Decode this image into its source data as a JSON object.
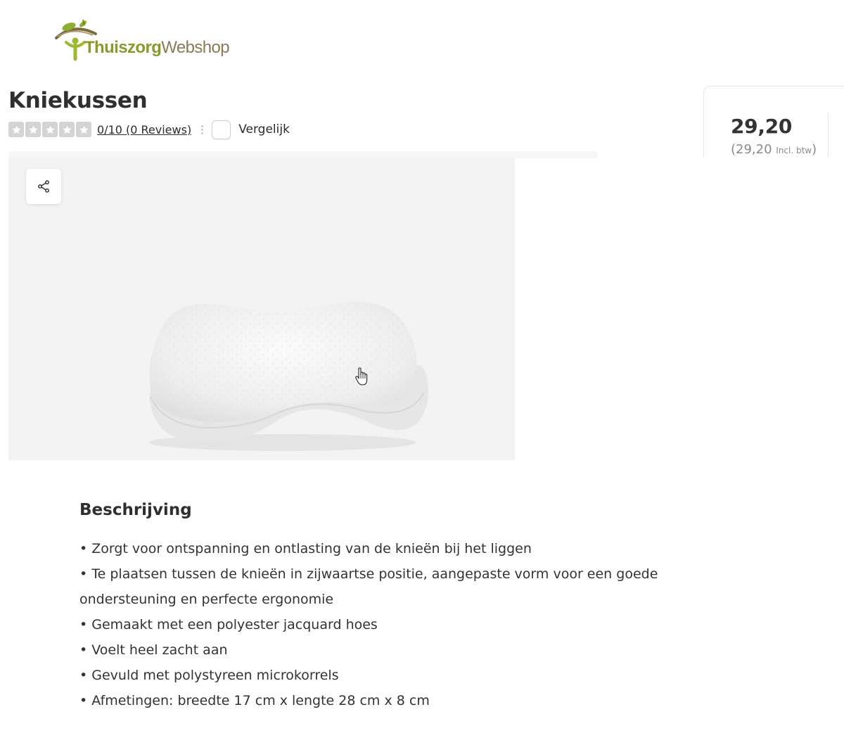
{
  "header": {
    "logo_part1": "Thuiszorg",
    "logo_part2": "Webshop"
  },
  "product": {
    "title": "Kniekussen",
    "rating": 0,
    "rating_max": 10,
    "reviews_link": "0/10 (0 Reviews)",
    "compare_label": "Vergelijk",
    "compare_checked": false
  },
  "price": {
    "main": "29,20",
    "incl_value": "(29,20 ",
    "incl_label": "Incl. btw",
    "incl_close": ")"
  },
  "icons": {
    "share": "share-icon",
    "star": "star-icon",
    "more": "kebab-icon",
    "cursor": "hand-pointer-icon"
  },
  "description": {
    "heading": "Beschrijving",
    "items": [
      "• Zorgt voor ontspanning en ontlasting van de knieën bij het liggen",
      "• Te plaatsen tussen de knieën in zijwaartse positie, aangepaste vorm voor een goede ondersteuning en perfecte ergonomie",
      "• Gemaakt met een polyester jacquard hoes",
      "• Voelt heel zacht aan",
      "• Gevuld met polystyreen microkorrels",
      "• Afmetingen: breedte 17 cm x lengte 28 cm x 8 cm"
    ]
  },
  "colors": {
    "brand_green": "#8a9a2a",
    "brand_brown": "#8a7a55",
    "star_empty": "#d4d4d4",
    "text": "#2b2b2b"
  }
}
